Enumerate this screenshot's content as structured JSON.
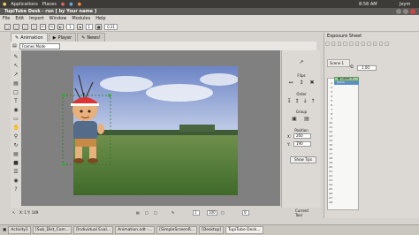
{
  "top_panel": {
    "applications": "Applications",
    "places": "Places",
    "time": "8:58 AM",
    "user": "Jeym"
  },
  "window": {
    "title": "TupiTube Desk - run [ by Your name ]"
  },
  "menu": {
    "items": [
      "File",
      "Edit",
      "Import",
      "Window",
      "Modules",
      "Help"
    ]
  },
  "toolbar": {
    "frame_a": "1",
    "frame_b": "1",
    "opacity": "0.31"
  },
  "tabs": [
    {
      "label": "Animation"
    },
    {
      "label": "Player"
    },
    {
      "label": "News!"
    }
  ],
  "mode_select": "Frames Mode",
  "right_panel": {
    "flips_label": "Flips",
    "order_label": "Order",
    "group_label": "Group",
    "position_label": "Position",
    "x_label": "X:",
    "x_value": "260",
    "y_label": "Y:",
    "y_value": "190",
    "show_tips": "Show Tips"
  },
  "exposure": {
    "title": "Exposure Sheet",
    "scene_tab": "Scene 1",
    "speed": "1.00",
    "layer_name": "Layer 1",
    "frame_name": "frame",
    "row_numbers": [
      "1",
      "2",
      "3",
      "4",
      "5",
      "6",
      "7",
      "8",
      "9",
      "10",
      "11",
      "12",
      "13",
      "14",
      "15",
      "16",
      "17",
      "18",
      "19",
      "20",
      "21",
      "22",
      "23",
      "24",
      "25",
      "26",
      "27",
      "28"
    ]
  },
  "status": {
    "coords": "X: 1 Y: 149",
    "frame": "1",
    "zoom": "100",
    "rotation": "0",
    "current_tool": "Current Tool"
  },
  "taskbar": {
    "items": [
      {
        "label": "Activity1"
      },
      {
        "label": "[Sub_Dist_Com..."
      },
      {
        "label": "[Individual Eval..."
      },
      {
        "label": "Animation.odt -..."
      },
      {
        "label": "[SimpleScreenR..."
      },
      {
        "label": "[Desktop]"
      },
      {
        "label": "TupiTube Desk..."
      }
    ]
  }
}
